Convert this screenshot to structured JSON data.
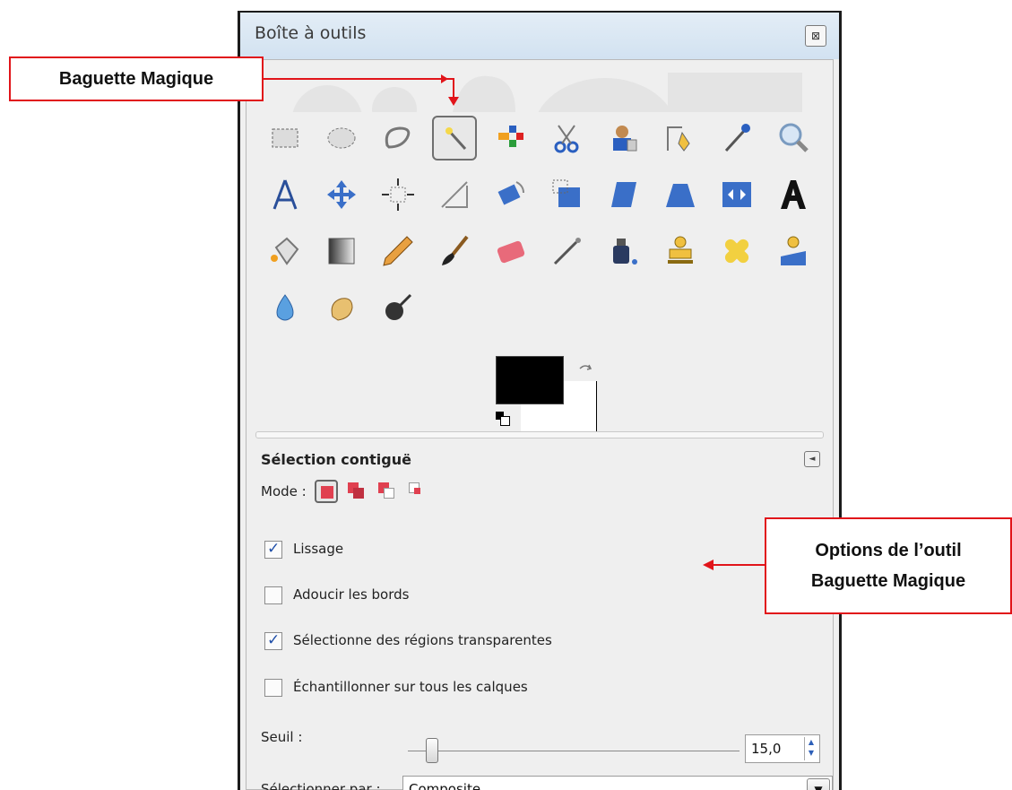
{
  "window": {
    "title": "Boîte à outils",
    "close_label": "⊠"
  },
  "tools": [
    "rect-select-icon",
    "ellipse-select-icon",
    "free-select-icon",
    "fuzzy-select-icon",
    "by-color-select-icon",
    "scissors-select-icon",
    "foreground-select-icon",
    "paths-icon",
    "color-picker-icon",
    "zoom-icon",
    "measure-icon",
    "move-icon",
    "align-icon",
    "crop-icon",
    "rotate-icon",
    "scale-icon",
    "shear-icon",
    "perspective-icon",
    "flip-icon",
    "text-icon",
    "bucket-fill-icon",
    "blend-icon",
    "pencil-icon",
    "paintbrush-icon",
    "eraser-icon",
    "airbrush-icon",
    "ink-icon",
    "clone-icon",
    "heal-icon",
    "perspective-clone-icon",
    "blur-icon",
    "smudge-icon",
    "dodge-burn-icon"
  ],
  "active_tool": "fuzzy-select-icon",
  "colors": {
    "foreground": "#000000",
    "background": "#ffffff",
    "callout_border": "#e1141a",
    "arrow": "#e1141a"
  },
  "options": {
    "title": "Sélection contiguë",
    "mode_label": "Mode :",
    "antialias": {
      "label": "Lissage",
      "checked": true
    },
    "feather": {
      "label": "Adoucir les bords",
      "checked": false
    },
    "transparent": {
      "label": "Sélectionne des régions transparentes",
      "checked": true
    },
    "sample_merged": {
      "label": "Échantillonner sur tous les calques",
      "checked": false
    },
    "threshold": {
      "label": "Seuil :",
      "value": "15,0"
    },
    "select_by": {
      "label": "Sélectionner par :",
      "value": "Composite"
    }
  },
  "callouts": {
    "wand": "Baguette Magique",
    "options_line1": "Options de l’outil",
    "options_line2": "Baguette Magique"
  }
}
